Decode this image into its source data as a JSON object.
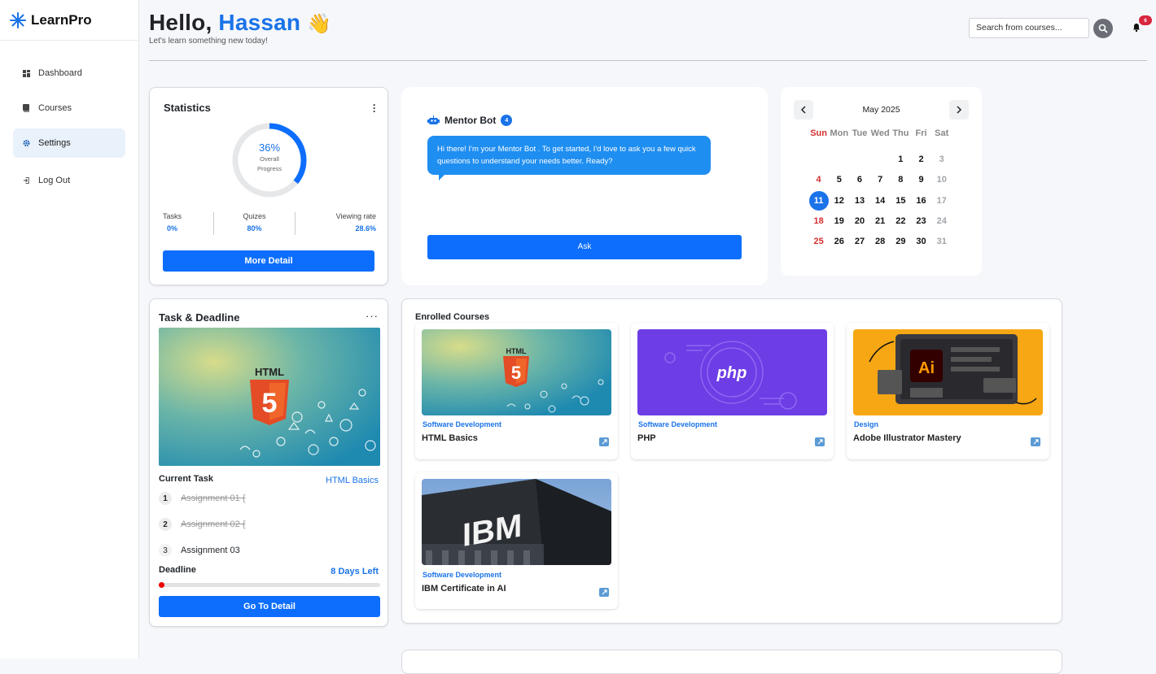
{
  "app": {
    "name": "LearnPro"
  },
  "sidebar": {
    "items": [
      {
        "label": "Dashboard",
        "icon": "grid-icon"
      },
      {
        "label": "Courses",
        "icon": "book-icon"
      },
      {
        "label": "Settings",
        "icon": "gear-icon",
        "active": true
      },
      {
        "label": "Log Out",
        "icon": "logout-icon"
      }
    ]
  },
  "header": {
    "greeting": "Hello,",
    "name": "Hassan",
    "emoji": "👋",
    "subtitle": "Let's learn something new today!",
    "search_placeholder": "Search from courses...",
    "notifications": "6"
  },
  "stats": {
    "title": "Statistics",
    "progress": 0.36,
    "progress_label": "36%",
    "progress_caption": "Overall Progress",
    "metrics": [
      {
        "label": "Tasks",
        "value": "0%"
      },
      {
        "label": "Quizes",
        "value": "80%"
      },
      {
        "label": "Viewing rate",
        "value": "28.6%"
      }
    ],
    "button": "More Detail"
  },
  "mentor": {
    "title": "Mentor Bot",
    "count": "4",
    "message": "Hi there! I'm your Mentor Bot . To get started, I'd love to ask you a few quick questions to understand your needs better. Ready?",
    "button": "Ask"
  },
  "calendar": {
    "month": "May 2025",
    "weekdays": [
      "Sun",
      "Mon",
      "Tue",
      "Wed",
      "Thu",
      "Fri",
      "Sat"
    ],
    "days": [
      "",
      "",
      "",
      "",
      "1",
      "2",
      "3",
      "4",
      "5",
      "6",
      "7",
      "8",
      "9",
      "10",
      "11",
      "12",
      "13",
      "14",
      "15",
      "16",
      "17",
      "18",
      "19",
      "20",
      "21",
      "22",
      "23",
      "24",
      "25",
      "26",
      "27",
      "28",
      "29",
      "30",
      "31"
    ],
    "today": "11"
  },
  "task": {
    "title": "Task & Deadline",
    "current_label": "Current Task",
    "current_course": "HTML Basics",
    "assignments": [
      {
        "num": "1",
        "title": "Assignment 01 {",
        "done": true
      },
      {
        "num": "2",
        "title": "Assignment 02 {",
        "done": true
      },
      {
        "num": "3",
        "title": "Assignment 03",
        "done": false
      }
    ],
    "deadline_label": "Deadline",
    "deadline_value": "8 Days Left",
    "deadline_progress": 0.02,
    "button": "Go To Detail"
  },
  "enrolled": {
    "title": "Enrolled Courses",
    "courses": [
      {
        "category": "Software Development",
        "name": "HTML Basics",
        "image": "html5"
      },
      {
        "category": "Software Development",
        "name": "PHP",
        "image": "php"
      },
      {
        "category": "Design",
        "name": "Adobe Illustrator Mastery",
        "image": "illustrator"
      },
      {
        "category": "Software Development",
        "name": "IBM Certificate in AI",
        "image": "ibm"
      }
    ]
  },
  "colors": {
    "accent": "#1a73e8",
    "button": "#0d6efd",
    "danger": "#d32f2f"
  }
}
